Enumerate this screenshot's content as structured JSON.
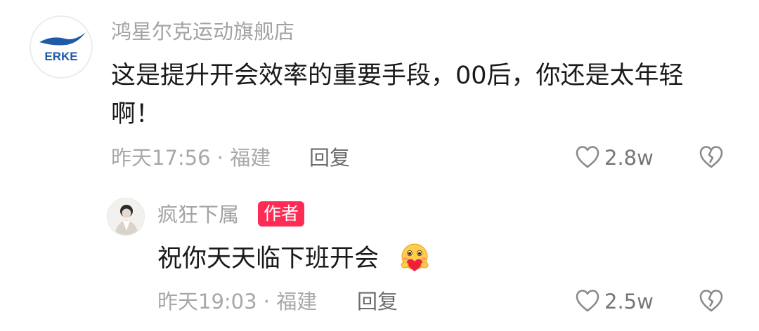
{
  "comment": {
    "username": "鸿星尔克运动旗舰店",
    "avatar_logo_text": "ERKE",
    "text_line1": "这是提升开会效率的重要手段，00后，你还是太年轻",
    "text_line2": "啊！",
    "meta": "昨天17:56 · 福建",
    "reply_label": "回复",
    "like_count": "2.8w",
    "icons": {
      "like": "heart-outline-icon",
      "dislike": "broken-heart-icon"
    }
  },
  "reply": {
    "username": "疯狂下属",
    "badge": "作者",
    "text": "祝你天天临下班开会",
    "emoji": "heart-hug-emoji",
    "meta": "昨天19:03 · 福建",
    "reply_label": "回复",
    "like_count": "2.5w",
    "icons": {
      "like": "heart-outline-icon",
      "dislike": "broken-heart-icon"
    }
  },
  "colors": {
    "badge": "#fe2c55",
    "username": "#a3a3a3",
    "brand": "#1e5aa8"
  }
}
